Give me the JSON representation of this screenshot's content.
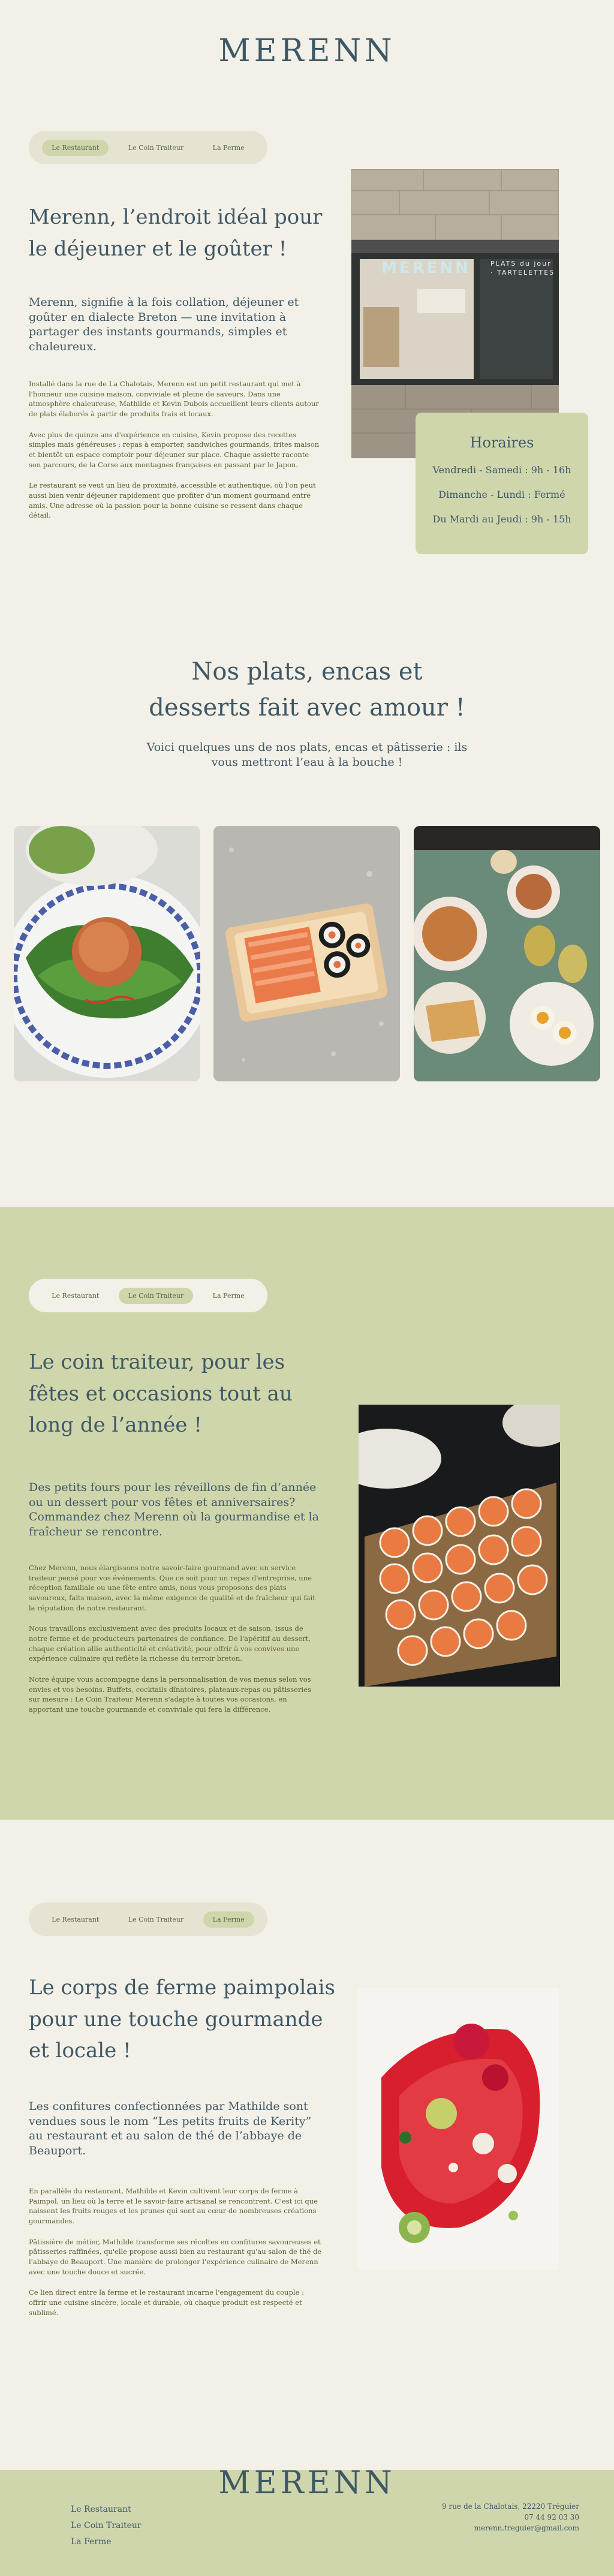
{
  "brand": {
    "name": "MERENN"
  },
  "nav": {
    "tabs": [
      "Le Restaurant",
      "Le Coin Traiteur",
      "La Ferme"
    ]
  },
  "restaurant": {
    "title": "Merenn, l’endroit idéal pour le déjeuner et le goûter !",
    "lead": "Merenn, signifie à la fois collation, déjeuner et goûter en dialecte Breton — une invitation à partager des instants gourmands, simples et chaleureux.",
    "p1": "Installé dans la rue de La Chalotais, Merenn est un petit restaurant qui met à l'honneur une cuisine maison, conviviale et pleine de saveurs. Dans une atmosphère chaleureuse, Mathilde et Kevin Dubois accueillent leurs clients autour de plats élaborés à partir de produits frais et locaux.",
    "p2": "Avec plus de quinze ans d'expérience en cuisine, Kevin propose des recettes simples mais généreuses : repas à emporter, sandwiches gourmands, frites maison et bientôt un espace comptoir pour déjeuner sur place. Chaque assiette raconte son parcours, de la Corse aux montagnes françaises en passant par le Japon.",
    "p3": "Le restaurant se veut un lieu de proximité, accessible et authentique, où l'on peut aussi bien venir déjeuner rapidement que profiter d'un moment gourmand entre amis. Une adresse où la passion pour la bonne cuisine se ressent dans chaque détail.",
    "shop_sign": "MERENN",
    "shop_sign_sub": "PLATS du jour · TARTELETTES"
  },
  "hours": {
    "title": "Horaires",
    "lines": [
      "Vendredi - Samedi : 9h - 16h",
      "Dimanche - Lundi : Fermé",
      "Du Mardi au Jeudi : 9h - 15h"
    ]
  },
  "dishes": {
    "title": "Nos plats, encas et desserts fait avec amour !",
    "subtitle": "Voici quelques uns de nos plats, encas et pâtisserie : ils vous mettront l’eau à la bouche !"
  },
  "traiteur": {
    "title": "Le coin traiteur, pour les fêtes et occasions tout au long de l’année !",
    "lead": "Des petits fours pour les réveillons de fin d’année ou un dessert pour vos fêtes et anniversaires? Commandez chez Merenn où la gourmandise et la fraîcheur se rencontre.",
    "p1": "Chez Merenn, nous élargissons notre savoir-faire gourmand avec un service traiteur pensé pour vos événements. Que ce soit pour un repas d'entreprise, une réception familiale ou une fête entre amis, nous vous proposons des plats savoureux, faits maison, avec la même exigence de qualité et de fraîcheur qui fait la réputation de notre restaurant.",
    "p2": "Nous travaillons exclusivement avec des produits locaux et de saison, issus de notre ferme et de producteurs partenaires de confiance. De l'apéritif au dessert, chaque création allie authenticité et créativité, pour offrir à vos convives une expérience culinaire qui reflète la richesse du terroir breton.",
    "p3": "Notre équipe vous accompagne dans la personnalisation de vos menus selon vos envies et vos besoins. Buffets, cocktails dînatoires, plateaux-repas ou pâtisseries sur mesure : Le Coin Traiteur Merenn s'adapte à toutes vos occasions, en apportant une touche gourmande et conviviale qui fera la différence."
  },
  "ferme": {
    "title": "Le corps de ferme paimpolais pour une touche gourmande et locale !",
    "lead": "Les confitures confectionnées par Mathilde sont vendues sous le nom “Les petits fruits de Kerity” au restaurant et au salon de thé de l’abbaye de Beauport.",
    "p1": "En parallèle du restaurant, Mathilde et Kevin cultivent leur corps de ferme à Paimpol, un lieu où la terre et le savoir-faire artisanal se rencontrent. C'est ici que naissent les fruits rouges et les prunes qui sont au cœur de nombreuses créations gourmandes.",
    "p2": "Pâtissière de métier, Mathilde transforme ses récoltes en confitures savoureuses et pâtisseries raffinées, qu'elle propose aussi bien au restaurant qu'au salon de thé de l'abbaye de Beauport. Une manière de prolonger l'expérience culinaire de Merenn avec une touche douce et sucrée.",
    "p3": "Ce lien direct entre la ferme et le restaurant incarne l'engagement du couple : offrir une cuisine sincère, locale et durable, où chaque produit est respecté et sublimé."
  },
  "footer": {
    "links": [
      "Le Restaurant",
      "Le Coin Traiteur",
      "La Ferme"
    ],
    "address": "9 rue de la Chalotais, 22220 Tréguier",
    "phone": "07 44 92 03 30",
    "email": "merenn.treguier@gmail.com"
  },
  "colors": {
    "background": "#f3f0e7",
    "accent_green": "#d0d6ac",
    "text_blue": "#3e5866",
    "body_olive": "#5c5a2a"
  }
}
